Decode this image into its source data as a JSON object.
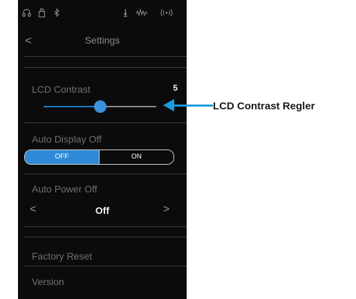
{
  "screen": {
    "status_icons": [
      "headphone-icon",
      "usb-icon",
      "bluetooth-icon",
      "metronome-icon",
      "waveform-icon",
      "wireless-icon"
    ],
    "back_symbol": "<",
    "title": "Settings",
    "lcd_contrast": {
      "label": "LCD Contrast",
      "value": "5",
      "level_fraction": 0.5
    },
    "auto_display_off": {
      "label": "Auto Display Off",
      "options": [
        "OFF",
        "ON"
      ],
      "selected": "OFF"
    },
    "auto_power_off": {
      "label": "Auto Power Off",
      "value": "Off",
      "prev_symbol": "<",
      "next_symbol": ">"
    },
    "factory_reset": {
      "label": "Factory Reset"
    },
    "version": {
      "label": "Version"
    }
  },
  "callout": {
    "label": "LCD Contrast Regler",
    "color": "#1a9bdc"
  },
  "colors": {
    "accent": "#2e8ad6",
    "background": "#0b0b0b"
  }
}
